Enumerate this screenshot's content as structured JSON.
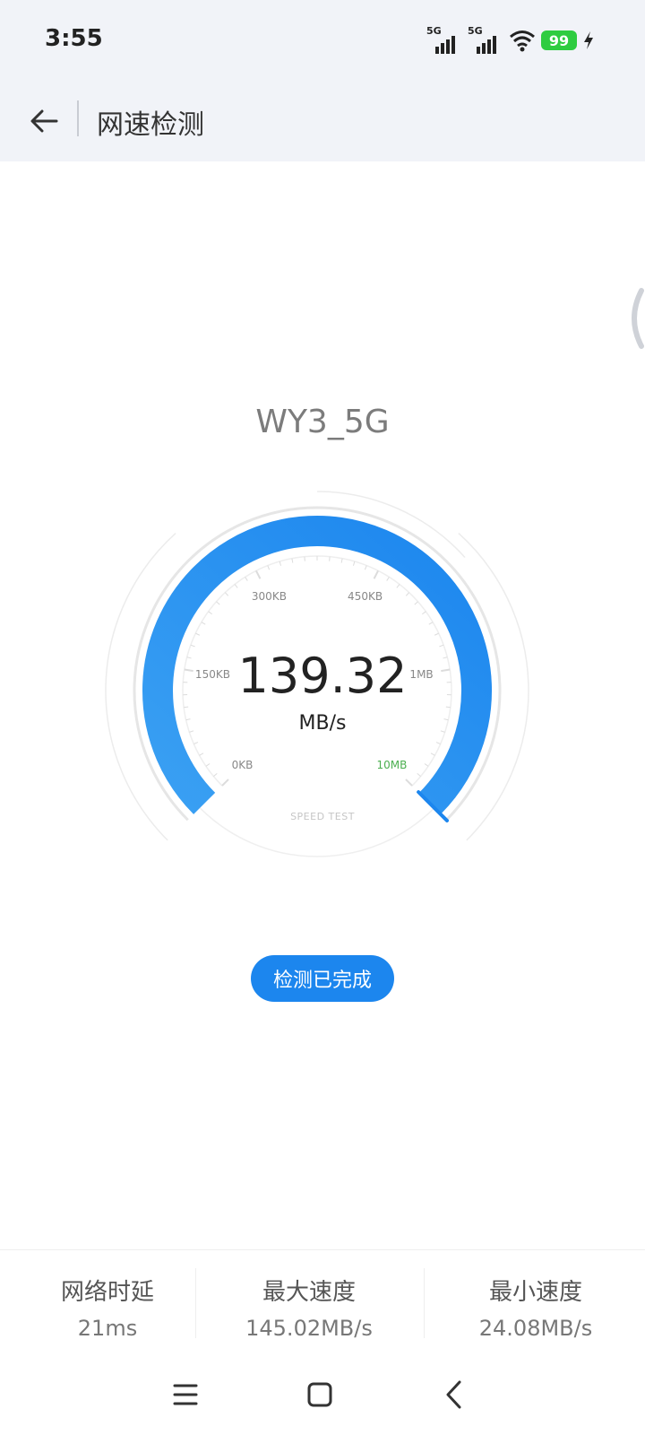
{
  "status_bar": {
    "time": "3:55",
    "signal_1_label": "5G",
    "signal_2_label": "5G",
    "battery": "99",
    "icons": [
      "signal-5g-icon",
      "signal-5g-icon",
      "wifi-icon",
      "battery-icon",
      "charging-icon"
    ]
  },
  "header": {
    "title": "网速检测",
    "back_icon": "arrow-left-icon"
  },
  "network": {
    "ssid": "WY3_5G"
  },
  "gauge": {
    "value": "139.32",
    "unit": "MB/s",
    "caption": "SPEED TEST",
    "ticks": [
      "0KB",
      "150KB",
      "300KB",
      "450KB",
      "1MB",
      "10MB"
    ],
    "highlight_tick": "10MB",
    "fill_fraction": 1.0,
    "accent_color": "#1c86ee"
  },
  "status": {
    "label": "检测已完成"
  },
  "stats": [
    {
      "label": "网络时延",
      "value": "21ms"
    },
    {
      "label": "最大速度",
      "value": "145.02MB/s"
    },
    {
      "label": "最小速度",
      "value": "24.08MB/s"
    }
  ],
  "nav": {
    "icons": [
      "menu-icon",
      "home-icon",
      "back-icon"
    ]
  }
}
